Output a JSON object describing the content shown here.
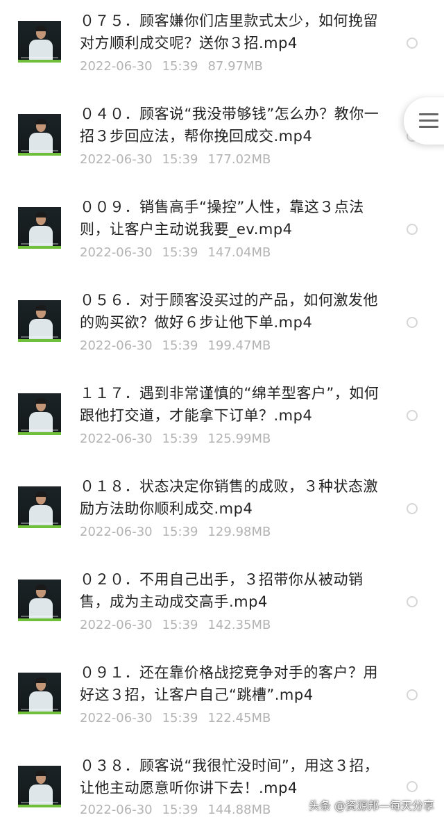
{
  "files": [
    {
      "title": "０７５．顾客嫌你们店里款式太少，如何挽留对方顺利成交呢？送你３招.mp4",
      "date": "2022-06-30",
      "time": "15:39",
      "size": "87.97MB"
    },
    {
      "title": "０４０．顾客说“我没带够钱”怎么办？教你一招３步回应法，帮你挽回成交.mp4",
      "date": "2022-06-30",
      "time": "15:39",
      "size": "177.02MB"
    },
    {
      "title": "００９．销售高手“操控”人性，靠这３点法则，让客户主动说我要_ev.mp4",
      "date": "2022-06-30",
      "time": "15:39",
      "size": "147.04MB"
    },
    {
      "title": "０５６．对于顾客没买过的产品，如何激发他的购买欲？做好６步让他下单.mp4",
      "date": "2022-06-30",
      "time": "15:39",
      "size": "199.47MB"
    },
    {
      "title": "１１７．遇到非常谨慎的“绵羊型客户”，如何跟他打交道，才能拿下订单？.mp4",
      "date": "2022-06-30",
      "time": "15:39",
      "size": "125.99MB"
    },
    {
      "title": "０１８．状态决定你销售的成败，３种状态激励方法助你顺利成交.mp4",
      "date": "2022-06-30",
      "time": "15:39",
      "size": "129.98MB"
    },
    {
      "title": "０２０．不用自己出手，３招带你从被动销售，成为主动成交高手.mp4",
      "date": "2022-06-30",
      "time": "15:39",
      "size": "142.35MB"
    },
    {
      "title": "０９１．还在靠价格战挖竞争对手的客户？用好这３招，让客户自己“跳槽”.mp4",
      "date": "2022-06-30",
      "time": "15:39",
      "size": "122.45MB"
    },
    {
      "title": "０３８．顾客说“我很忙没时间”，用这３招，让他主动愿意听你讲下去！.mp4",
      "date": "2022-06-30",
      "time": "15:39",
      "size": "144.88MB"
    }
  ],
  "side_menu": {
    "icon": "hamburger-menu-icon"
  },
  "watermark": "头条 @资源邦—每天分享",
  "colors": {
    "title": "#222222",
    "meta": "#b3b3b3",
    "radio": "#d6d6d6",
    "grass": "#6fbf3a"
  }
}
